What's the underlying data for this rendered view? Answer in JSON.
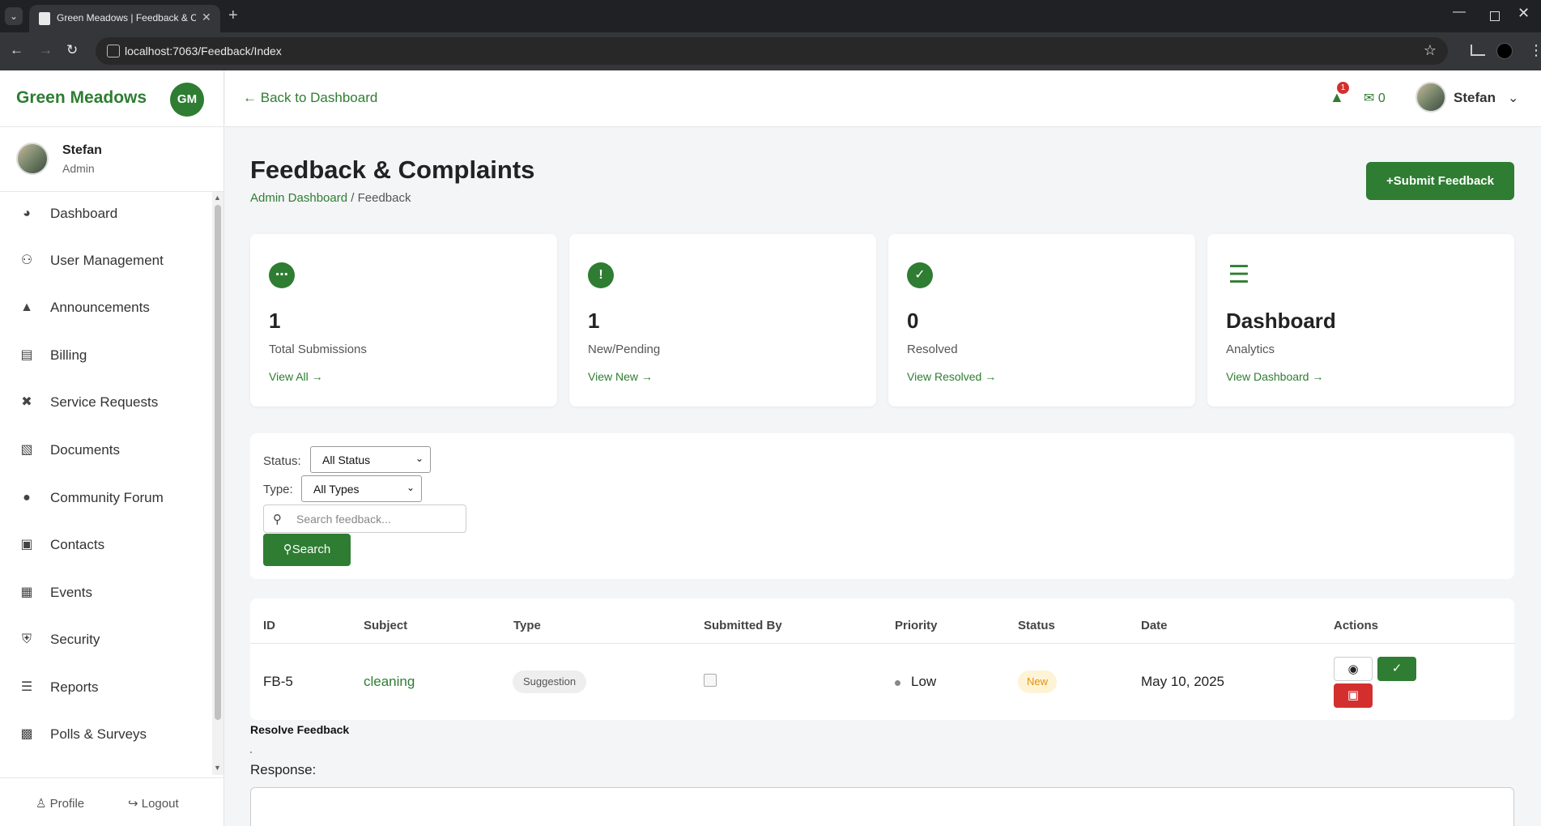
{
  "browser": {
    "tab_title": "Green Meadows | Feedback & Complaints",
    "url": "localhost:7063/Feedback/Index"
  },
  "sidebar": {
    "brand": "Green Meadows",
    "logo_text": "GM",
    "user": {
      "name": "Stefan",
      "role": "Admin"
    },
    "items": [
      {
        "label": "Dashboard",
        "icon": "dashboard-icon"
      },
      {
        "label": "User Management",
        "icon": "users-icon"
      },
      {
        "label": "Announcements",
        "icon": "megaphone-icon"
      },
      {
        "label": "Billing",
        "icon": "invoice-icon"
      },
      {
        "label": "Service Requests",
        "icon": "tools-icon"
      },
      {
        "label": "Documents",
        "icon": "document-icon"
      },
      {
        "label": "Community Forum",
        "icon": "comments-icon"
      },
      {
        "label": "Contacts",
        "icon": "address-book-icon"
      },
      {
        "label": "Events",
        "icon": "calendar-icon"
      },
      {
        "label": "Security",
        "icon": "shield-icon"
      },
      {
        "label": "Reports",
        "icon": "chart-bar-icon"
      },
      {
        "label": "Polls & Surveys",
        "icon": "poll-icon"
      }
    ],
    "footer": {
      "profile": "Profile",
      "logout": "Logout"
    }
  },
  "header": {
    "back_label": "Back to Dashboard",
    "notification_count": "1",
    "message_count": "0",
    "user_name": "Stefan"
  },
  "main": {
    "title": "Feedback & Complaints",
    "breadcrumb": {
      "root": "Admin Dashboard",
      "separator": "/",
      "current": "Feedback"
    },
    "submit_label": "Submit Feedback",
    "cards": [
      {
        "icon": "chat-icon",
        "value": "1",
        "label": "Total Submissions",
        "link": "View All"
      },
      {
        "icon": "exclamation-icon",
        "value": "1",
        "label": "New/Pending",
        "link": "View New"
      },
      {
        "icon": "check-circle-icon",
        "value": "0",
        "label": "Resolved",
        "link": "View Resolved"
      },
      {
        "icon": "chart-line-icon",
        "value": "Dashboard",
        "label": "Analytics",
        "link": "View Dashboard"
      }
    ],
    "filters": {
      "status_label": "Status:",
      "status_value": "All Status",
      "type_label": "Type:",
      "type_value": "All Types",
      "search_placeholder": "Search feedback...",
      "search_button": "Search"
    },
    "table": {
      "columns": [
        "ID",
        "Subject",
        "Type",
        "Submitted By",
        "Priority",
        "Status",
        "Date",
        "Actions"
      ],
      "rows": [
        {
          "id": "FB-5",
          "subject": "cleaning",
          "type": "Suggestion",
          "submitted_by": "",
          "priority": "Low",
          "status": "New",
          "date": "May 10, 2025"
        }
      ]
    },
    "modal": {
      "title": "Resolve Feedback",
      "response_label": "Response:"
    }
  },
  "colors": {
    "brand": "#2e7d32",
    "danger": "#d32f2f",
    "warning_text": "#e0920c",
    "warning_bg": "#fff3d6"
  }
}
